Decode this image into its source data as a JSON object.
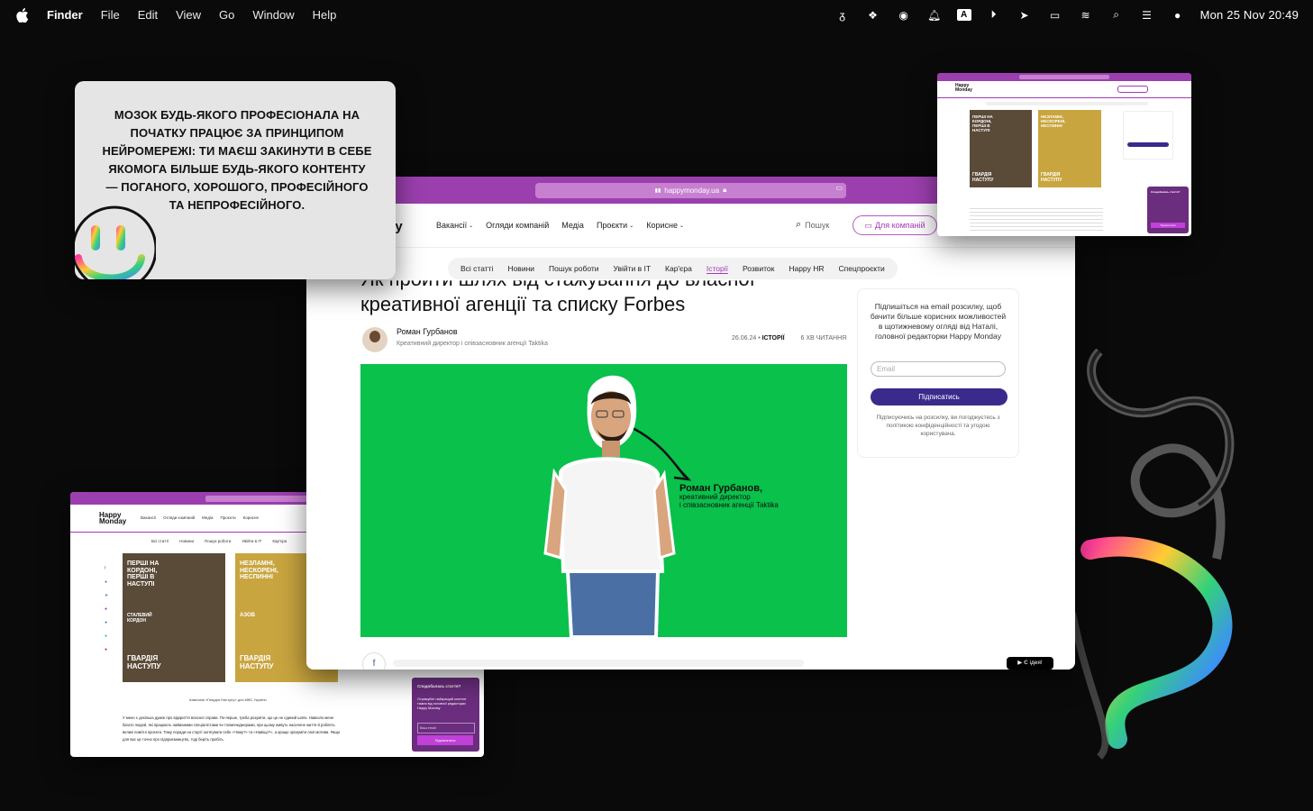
{
  "menubar": {
    "app": "Finder",
    "items": [
      "File",
      "Edit",
      "View",
      "Go",
      "Window",
      "Help"
    ],
    "clock": "Mon 25 Nov  20:49"
  },
  "quote": {
    "text": "МОЗОК БУДЬ-ЯКОГО ПРОФЕСІОНАЛА НА ПОЧАТКУ ПРАЦЮЄ ЗА ПРИНЦИПОМ НЕЙРОМЕРЕЖІ: ТИ МАЄШ ЗАКИНУТИ В СЕБЕ ЯКОМОГА БІЛЬШЕ БУДЬ-ЯКОГО КОНТЕНТУ — ПОГАНОГО, ХОРОШОГО, ПРОФЕСІЙНОГО ТА НЕПРОФЕСІЙНОГО."
  },
  "browser": {
    "url": "happymonday.ua",
    "logo_fragment": "y\nay",
    "nav": [
      "Вакансії",
      "Огляди компаній",
      "Медіа",
      "Проєкти",
      "Корисне"
    ],
    "search": "Пошук",
    "for_companies": "Для компаній",
    "tabs": [
      "Всі статті",
      "Новини",
      "Пошук роботи",
      "Увійти в IT",
      "Кар'єра",
      "Історії",
      "Розвиток",
      "Happy HR",
      "Спецпроєкти"
    ],
    "active_tab": "Історії",
    "title_line1": "Як пройти шлях від стажування до власної",
    "title_line2": "креативної агенції та списку Forbes",
    "author": "Роман Гурбанов",
    "author_role": "Креативний директор і співзасновник агенції Taktika",
    "date": "26.06.24",
    "category": "ІСТОРІЇ",
    "read_time": "6 ХВ ЧИТАННЯ",
    "hero_name": "Роман Гурбанов,",
    "hero_role1": "креативний директор",
    "hero_role2": "і співзасновник агенції Taktika",
    "subscribe_text": "Підпишіться на email розсилку, щоб бачити більше корисних можливостей в щотижневому огляді від Наталі, головної редакторки Happy Monday",
    "email_placeholder": "Email",
    "subscribe_button": "Підписатись",
    "legal": "Підписуючись на розсилку, ви погоджуєтесь з політикою конфіденційності та угодою користувача.",
    "fb": "f",
    "idea": "Є ідея!"
  },
  "thumb_bl": {
    "logo": "Happy Monday",
    "nav": [
      "Вакансії",
      "Огляди компаній",
      "Медіа",
      "Проєкти",
      "Корисне"
    ],
    "tabs": [
      "Всі статті",
      "Новини",
      "Пошук роботи",
      "Увійти в IT",
      "Кар'єра"
    ],
    "poster1_text": "ПЕРШІ НА КОРДОНІ, ПЕРШІ В НАСТУПІ",
    "poster1_sub": "СТАЛЕВИЙ КОРДОН",
    "poster2_text": "НЕЗЛАМНІ, НЕСКОРЕНІ, НЕСПИННІ",
    "poster2_sub": "АЗОВ",
    "brand": "ГВАРДІЯ НАСТУПУ",
    "caption": "Кампанія «Гвардія Наступу» для МВС України",
    "body": "У мене є декілька думок про відкриття власної справи. По-перше, треба розуміти, що це не єдиний шлях. Навколо мене багато людей, які працюють найманими спеціалістами чи топменеджерами, при цьому живуть насичене життя й роблять великі помітні проєкти. Тому поради на старті затягувати себе «Чому?» та «Навіщо?», а краще зрозуміти свої мотиви. Якщо для вас це точно про підприємництво, тоді беріть пробіть.",
    "popup_title": "Сподобалась стаття?",
    "popup_text": "Отримуйте найкращий контент тижня від головної редакторки Happy Monday",
    "popup_email": "Ваш email",
    "popup_btn": "Підписатися"
  },
  "thumb_tr": {
    "logo": "Happy Monday",
    "brand": "ГВАРДІЯ НАСТУПУ",
    "poster1_text": "ПЕРШІ НА КОРДОНІ, ПЕРШІ В НАСТУПІ",
    "poster2_text": "НЕЗЛАМНІ, НЕСКОРЕНІ, НЕСПИННІ",
    "popup_title": "Сподобалась стаття?",
    "popup_btn": "Підписатися"
  }
}
